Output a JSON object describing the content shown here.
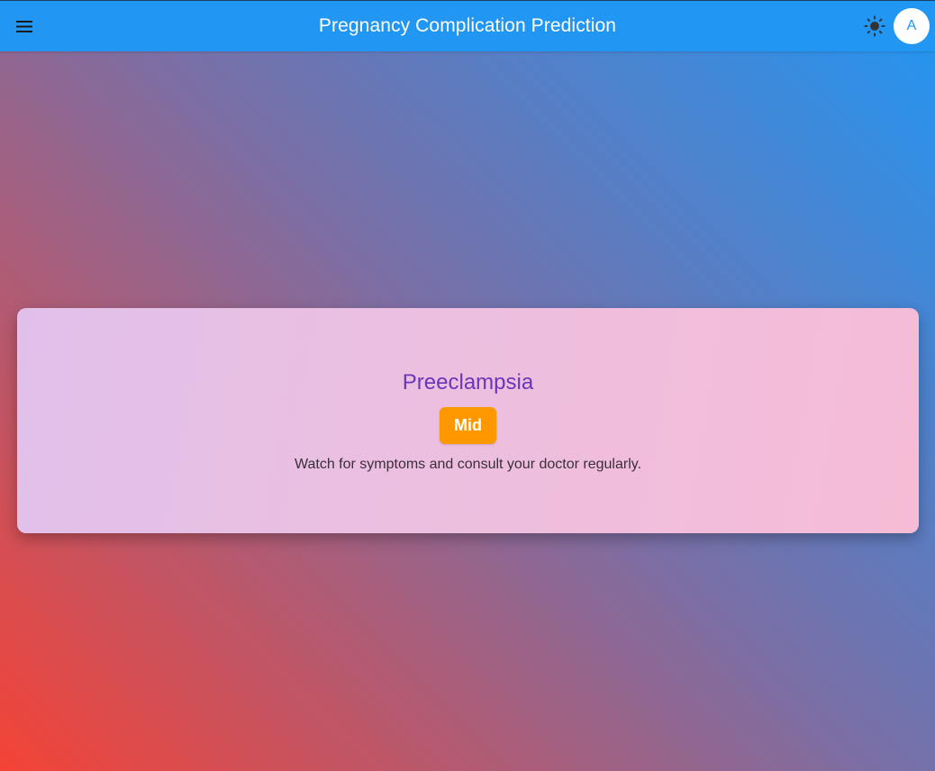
{
  "app_bar": {
    "title": "Pregnancy Complication Prediction",
    "menu_icon": "hamburger-menu-icon",
    "theme_icon": "sun-icon",
    "avatar_letter": "A"
  },
  "prediction_card": {
    "condition": "Preeclampsia",
    "risk_level": "Mid",
    "advice": "Watch for symptoms and consult your doctor regularly."
  },
  "colors": {
    "app_bar": "#2196f3",
    "gradient_start": "#f44336",
    "gradient_end": "#2196f3",
    "condition_text": "#6a35b8",
    "risk_badge": "#ff9800"
  }
}
